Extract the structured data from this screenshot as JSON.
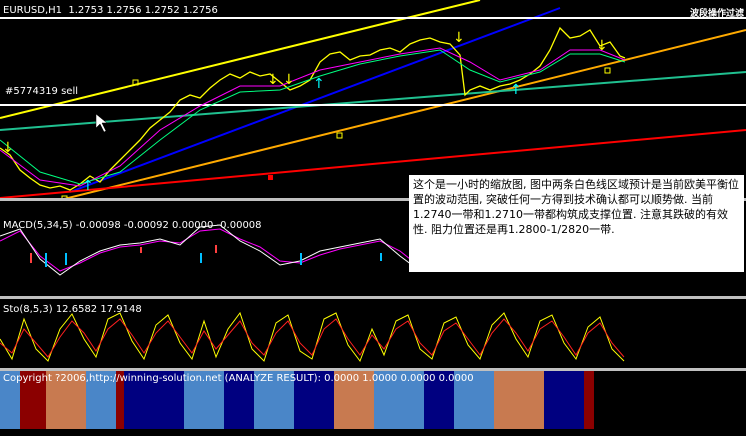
{
  "main_chart": {
    "title": "EURUSD,H1  1.2753 1.2756 1.2752 1.2756",
    "order_label": "#5774319 sell",
    "corner_label": "波段操作过滤"
  },
  "note": {
    "text": "这个是一小时的缩放图, 图中两条白色线区域预计是当前欧美平衡位置的波动范围, 突破任何一方得到技术确认都可以顺势做. 当前1.2740一带和1.2710一带都构筑成支撑位置. 注意其跌破的有效性. 阻力位置还是再1.2800-1/2820一带."
  },
  "macd": {
    "label": "MACD(5,34,5) -0.00098 -0.00092 0.00000 -0.00008"
  },
  "stoch": {
    "label": "Sto(8,5,3) 12.6582 17.9148"
  },
  "analyze": {
    "label": "Copyright ?2006,http://winning-solution.net (ANALYZE RESULT): 0.0000 1.0000 0.0000 0.0000",
    "bands": [
      "#4a86c8",
      "#8b0000",
      "#c87a50",
      "#4a86c8",
      "#8b0000",
      "#000080",
      "#4a86c8",
      "#000080",
      "#4a86c8",
      "#000080",
      "#c87a50",
      "#4a86c8",
      "#000080",
      "#4a86c8",
      "#c87a50",
      "#000080",
      "#8b0000"
    ]
  },
  "colors": {
    "price_line": "#ffff00",
    "trend_blue": "#0000ff",
    "trend_teal": "#20c090",
    "trend_red": "#ff0000",
    "trend_orange": "#ffaa00",
    "white_lines": "#ffffff"
  }
}
